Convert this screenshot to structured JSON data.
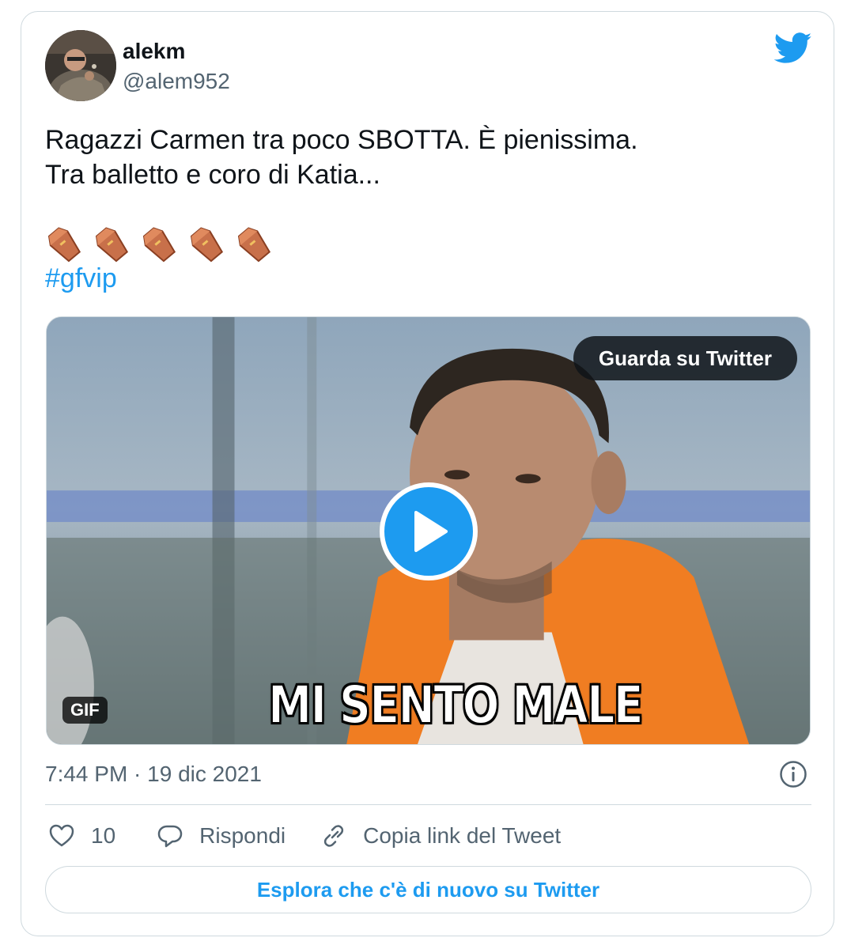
{
  "tweet": {
    "author": {
      "display_name": "alekm",
      "handle": "@alem952"
    },
    "text_lines": [
      "Ragazzi Carmen tra poco SBOTTA. È pienissima.",
      "Tra balletto e coro di Katia..."
    ],
    "emoji_icon": "coffin-emoji",
    "emoji_count": 5,
    "hashtag": "#gfvip",
    "media": {
      "watch_label": "Guarda su Twitter",
      "gif_badge": "GIF",
      "caption": "MI SENTO MALE",
      "play_icon": "play-icon"
    },
    "timestamp": "7:44 PM · 19 dic 2021",
    "actions": {
      "like_count": "10",
      "reply_label": "Rispondi",
      "copy_link_label": "Copia link del Tweet"
    },
    "explore_label": "Esplora che c'è di nuovo su Twitter"
  },
  "colors": {
    "accent": "#1d9bf0",
    "secondary_text": "#536471",
    "border": "#cfd9de"
  }
}
